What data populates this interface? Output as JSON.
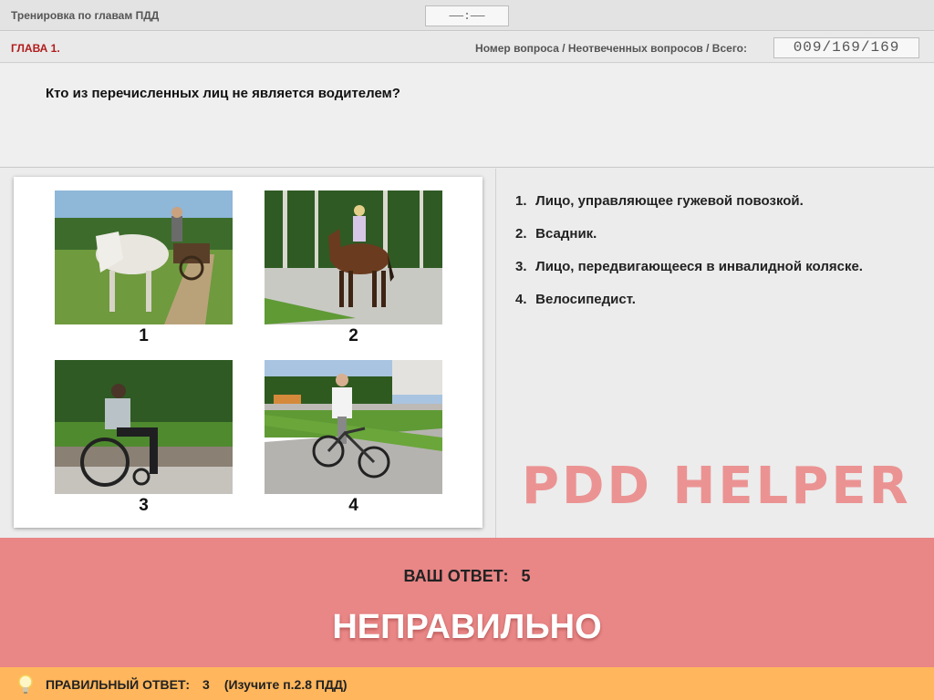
{
  "header": {
    "app_title": "Тренировка по главам ПДД",
    "timer": "——:——"
  },
  "chapter": {
    "label": "ГЛАВА 1.",
    "counter_label": "Номер вопроса / Неотвеченных вопросов / Всего:",
    "counter_value": "009/169/169"
  },
  "question": {
    "text": "Кто из перечисленных лиц не является водителем?"
  },
  "photos": [
    {
      "number": "1",
      "icon": "horse-cart-photo"
    },
    {
      "number": "2",
      "icon": "horse-rider-photo"
    },
    {
      "number": "3",
      "icon": "wheelchair-photo"
    },
    {
      "number": "4",
      "icon": "cyclist-photo"
    }
  ],
  "answers": [
    {
      "number": "1.",
      "text": "Лицо, управляющее гужевой повозкой."
    },
    {
      "number": "2.",
      "text": "Всадник."
    },
    {
      "number": "3.",
      "text": "Лицо, передвигающееся в инвалидной коляске."
    },
    {
      "number": "4.",
      "text": "Велосипедист."
    }
  ],
  "watermark": "PDD HELPER",
  "result": {
    "your_answer_label": "ВАШ  ОТВЕТ:",
    "your_answer_value": "5",
    "verdict": "НЕПРАВИЛЬНО",
    "color": "#e98686"
  },
  "correct": {
    "label": "ПРАВИЛЬНЫЙ ОТВЕТ:",
    "value": "3",
    "hint": "(Изучите п.2.8 ПДД)",
    "icon": "lightbulb-icon",
    "color": "#ffb65c"
  }
}
